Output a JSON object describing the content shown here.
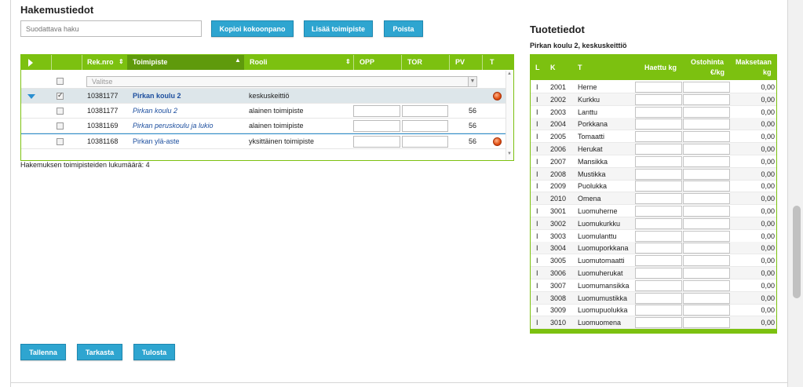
{
  "left": {
    "title": "Hakemustiedot",
    "search_placeholder": "Suodattava haku",
    "buttons": {
      "copy": "Kopioi kokoonpano",
      "add": "Lisää toimipiste",
      "delete": "Poista"
    },
    "columns": {
      "rek": "Rek.nro",
      "toimipiste": "Toimipiste",
      "rooli": "Rooli",
      "opp": "OPP",
      "tor": "TOR",
      "pv": "PV",
      "t": "T"
    },
    "select_placeholder": "Valitse",
    "rows": [
      {
        "rek": "10381177",
        "name": "Pirkan koulu 2",
        "role": "keskuskeittiö",
        "pv": "",
        "checked": true,
        "status": "red"
      },
      {
        "rek": "10381177",
        "name": "Pirkan koulu 2",
        "role": "alainen toimipiste",
        "pv": "56",
        "checked": false,
        "status": ""
      },
      {
        "rek": "10381169",
        "name": "Pirkan peruskoulu ja lukio",
        "role": "alainen toimipiste",
        "pv": "56",
        "checked": false,
        "status": ""
      },
      {
        "rek": "10381168",
        "name": "Pirkan ylä-aste",
        "role": "yksittäinen toimipiste",
        "pv": "56",
        "checked": false,
        "status": "red"
      }
    ],
    "count_text": "Hakemuksen toimipisteiden lukumäärä: 4"
  },
  "right": {
    "title": "Tuotetiedot",
    "subtitle": "Pirkan koulu 2, keskuskeittiö",
    "columns": {
      "l": "L",
      "k": "K",
      "t": "T",
      "haettu": "Haettu kg",
      "ostohinta_1": "Ostohinta",
      "ostohinta_2": "€/kg",
      "maksetaan_1": "Maksetaan",
      "maksetaan_2": "kg"
    },
    "rows": [
      {
        "l": "I",
        "k": "2001",
        "t": "Herne",
        "m": "0,00"
      },
      {
        "l": "I",
        "k": "2002",
        "t": "Kurkku",
        "m": "0,00"
      },
      {
        "l": "I",
        "k": "2003",
        "t": "Lanttu",
        "m": "0,00"
      },
      {
        "l": "I",
        "k": "2004",
        "t": "Porkkana",
        "m": "0,00"
      },
      {
        "l": "I",
        "k": "2005",
        "t": "Tomaatti",
        "m": "0,00"
      },
      {
        "l": "I",
        "k": "2006",
        "t": "Herukat",
        "m": "0,00"
      },
      {
        "l": "I",
        "k": "2007",
        "t": "Mansikka",
        "m": "0,00"
      },
      {
        "l": "I",
        "k": "2008",
        "t": "Mustikka",
        "m": "0,00"
      },
      {
        "l": "I",
        "k": "2009",
        "t": "Puolukka",
        "m": "0,00"
      },
      {
        "l": "I",
        "k": "2010",
        "t": "Omena",
        "m": "0,00"
      },
      {
        "l": "I",
        "k": "3001",
        "t": "Luomuherne",
        "m": "0,00"
      },
      {
        "l": "I",
        "k": "3002",
        "t": "Luomukurkku",
        "m": "0,00"
      },
      {
        "l": "I",
        "k": "3003",
        "t": "Luomulanttu",
        "m": "0,00"
      },
      {
        "l": "I",
        "k": "3004",
        "t": "Luomuporkkana",
        "m": "0,00"
      },
      {
        "l": "I",
        "k": "3005",
        "t": "Luomutomaatti",
        "m": "0,00"
      },
      {
        "l": "I",
        "k": "3006",
        "t": "Luomuherukat",
        "m": "0,00"
      },
      {
        "l": "I",
        "k": "3007",
        "t": "Luomumansikka",
        "m": "0,00"
      },
      {
        "l": "I",
        "k": "3008",
        "t": "Luomumustikka",
        "m": "0,00"
      },
      {
        "l": "I",
        "k": "3009",
        "t": "Luomupuolukka",
        "m": "0,00"
      },
      {
        "l": "I",
        "k": "3010",
        "t": "Luomuomena",
        "m": "0,00"
      }
    ]
  },
  "footer": {
    "save": "Tallenna",
    "check": "Tarkasta",
    "print": "Tulosta"
  },
  "colors": {
    "accent_green": "#7cc110",
    "button_blue": "#2ea5d0",
    "link_blue": "#1c4e9e",
    "status_red": "#e04e10"
  }
}
